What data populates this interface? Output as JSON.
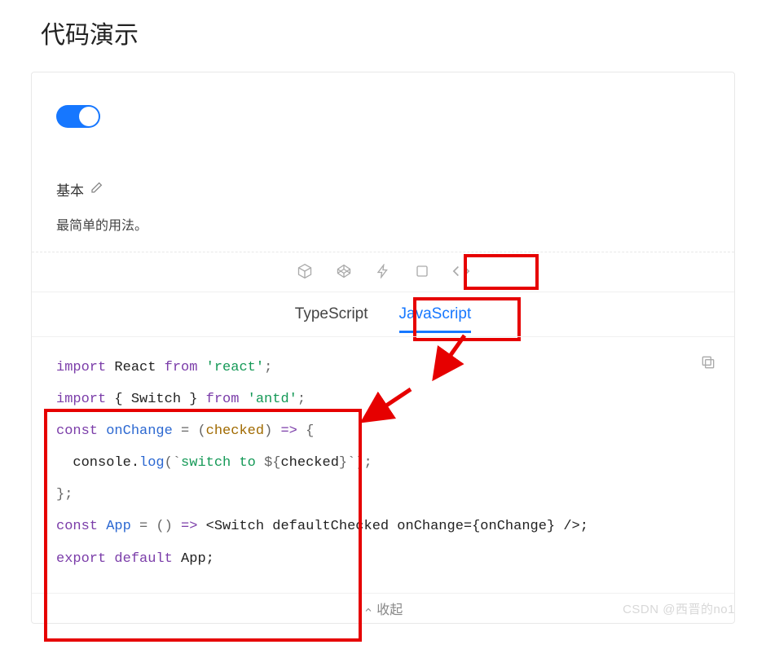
{
  "page_title": "代码演示",
  "demo": {
    "title": "基本",
    "description": "最简单的用法。"
  },
  "tabs": {
    "ts": "TypeScript",
    "js": "JavaScript"
  },
  "code": {
    "lines": [
      [
        {
          "t": "import",
          "c": "kw"
        },
        {
          "t": " React ",
          "c": "ident"
        },
        {
          "t": "from",
          "c": "kw"
        },
        {
          "t": " ",
          "c": "ident"
        },
        {
          "t": "'react'",
          "c": "str"
        },
        {
          "t": ";",
          "c": "punc"
        }
      ],
      [
        {
          "t": "import",
          "c": "kw"
        },
        {
          "t": " { Switch } ",
          "c": "ident"
        },
        {
          "t": "from",
          "c": "kw"
        },
        {
          "t": " ",
          "c": "ident"
        },
        {
          "t": "'antd'",
          "c": "str"
        },
        {
          "t": ";",
          "c": "punc"
        }
      ],
      [
        {
          "t": "const",
          "c": "kw"
        },
        {
          "t": " ",
          "c": "ident"
        },
        {
          "t": "onChange",
          "c": "fn"
        },
        {
          "t": " = (",
          "c": "punc"
        },
        {
          "t": "checked",
          "c": "param"
        },
        {
          "t": ") ",
          "c": "punc"
        },
        {
          "t": "=>",
          "c": "kw"
        },
        {
          "t": " {",
          "c": "punc"
        }
      ],
      [
        {
          "t": "  console.",
          "c": "ident"
        },
        {
          "t": "log",
          "c": "fn"
        },
        {
          "t": "(`",
          "c": "punc"
        },
        {
          "t": "switch to ",
          "c": "str"
        },
        {
          "t": "${",
          "c": "punc"
        },
        {
          "t": "checked",
          "c": "ident"
        },
        {
          "t": "}",
          "c": "punc"
        },
        {
          "t": "`);",
          "c": "punc"
        }
      ],
      [
        {
          "t": "};",
          "c": "punc"
        }
      ],
      [
        {
          "t": "const",
          "c": "kw"
        },
        {
          "t": " ",
          "c": "ident"
        },
        {
          "t": "App",
          "c": "fn"
        },
        {
          "t": " = () ",
          "c": "punc"
        },
        {
          "t": "=>",
          "c": "kw"
        },
        {
          "t": " <Switch defaultChecked onChange={onChange} />;",
          "c": "ident"
        }
      ],
      [
        {
          "t": "export",
          "c": "kw"
        },
        {
          "t": " ",
          "c": "ident"
        },
        {
          "t": "default",
          "c": "kw"
        },
        {
          "t": " App;",
          "c": "ident"
        }
      ]
    ]
  },
  "watermark": "CSDN @西晋的no1",
  "bottom_hint": "收起"
}
